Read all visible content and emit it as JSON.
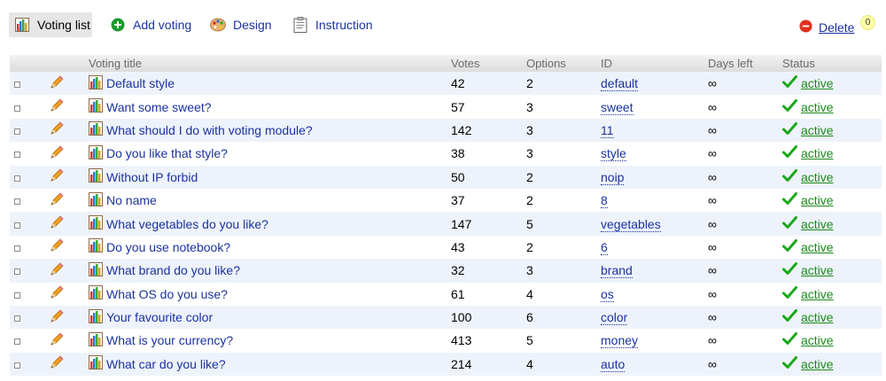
{
  "toolbar": {
    "voting_list": "Voting list",
    "add_voting": "Add voting",
    "design": "Design",
    "instruction": "Instruction",
    "delete": "Delete",
    "delete_count": "0"
  },
  "table": {
    "headers": {
      "title": "Voting title",
      "votes": "Votes",
      "options": "Options",
      "id": "ID",
      "days_left": "Days left",
      "status": "Status"
    },
    "rows": [
      {
        "title": "Default style",
        "votes": "42",
        "options": "2",
        "id": "default",
        "days": "∞",
        "status": "active"
      },
      {
        "title": "Want some sweet?",
        "votes": "57",
        "options": "3",
        "id": "sweet",
        "days": "∞",
        "status": "active"
      },
      {
        "title": "What should I do with voting module?",
        "votes": "142",
        "options": "3",
        "id": "11",
        "days": "∞",
        "status": "active"
      },
      {
        "title": "Do you like that style?",
        "votes": "38",
        "options": "3",
        "id": "style",
        "days": "∞",
        "status": "active"
      },
      {
        "title": "Without IP forbid",
        "votes": "50",
        "options": "2",
        "id": "noip",
        "days": "∞",
        "status": "active"
      },
      {
        "title": "No name",
        "votes": "37",
        "options": "2",
        "id": "8",
        "days": "∞",
        "status": "active"
      },
      {
        "title": "What vegetables do you like?",
        "votes": "147",
        "options": "5",
        "id": "vegetables",
        "days": "∞",
        "status": "active"
      },
      {
        "title": "Do you use notebook?",
        "votes": "43",
        "options": "2",
        "id": "6",
        "days": "∞",
        "status": "active"
      },
      {
        "title": "What brand do you like?",
        "votes": "32",
        "options": "3",
        "id": "brand",
        "days": "∞",
        "status": "active"
      },
      {
        "title": "What OS do you use?",
        "votes": "61",
        "options": "4",
        "id": "os",
        "days": "∞",
        "status": "active"
      },
      {
        "title": "Your favourite color",
        "votes": "100",
        "options": "6",
        "id": "color",
        "days": "∞",
        "status": "active"
      },
      {
        "title": "What is your currency?",
        "votes": "413",
        "options": "5",
        "id": "money",
        "days": "∞",
        "status": "active"
      },
      {
        "title": "What car do you like?",
        "votes": "214",
        "options": "4",
        "id": "auto",
        "days": "∞",
        "status": "active"
      }
    ]
  },
  "icons": {
    "voting_list": "bar-chart-icon",
    "add_voting": "plus-circle-icon",
    "design": "palette-icon",
    "instruction": "clipboard-icon",
    "delete": "minus-circle-icon",
    "edit": "pencil-icon",
    "status": "checkmark-icon"
  },
  "colors": {
    "link": "#1a32a0",
    "active": "#1a8a1a",
    "row_alt": "#eef3fb",
    "delete_red": "#e03020"
  }
}
